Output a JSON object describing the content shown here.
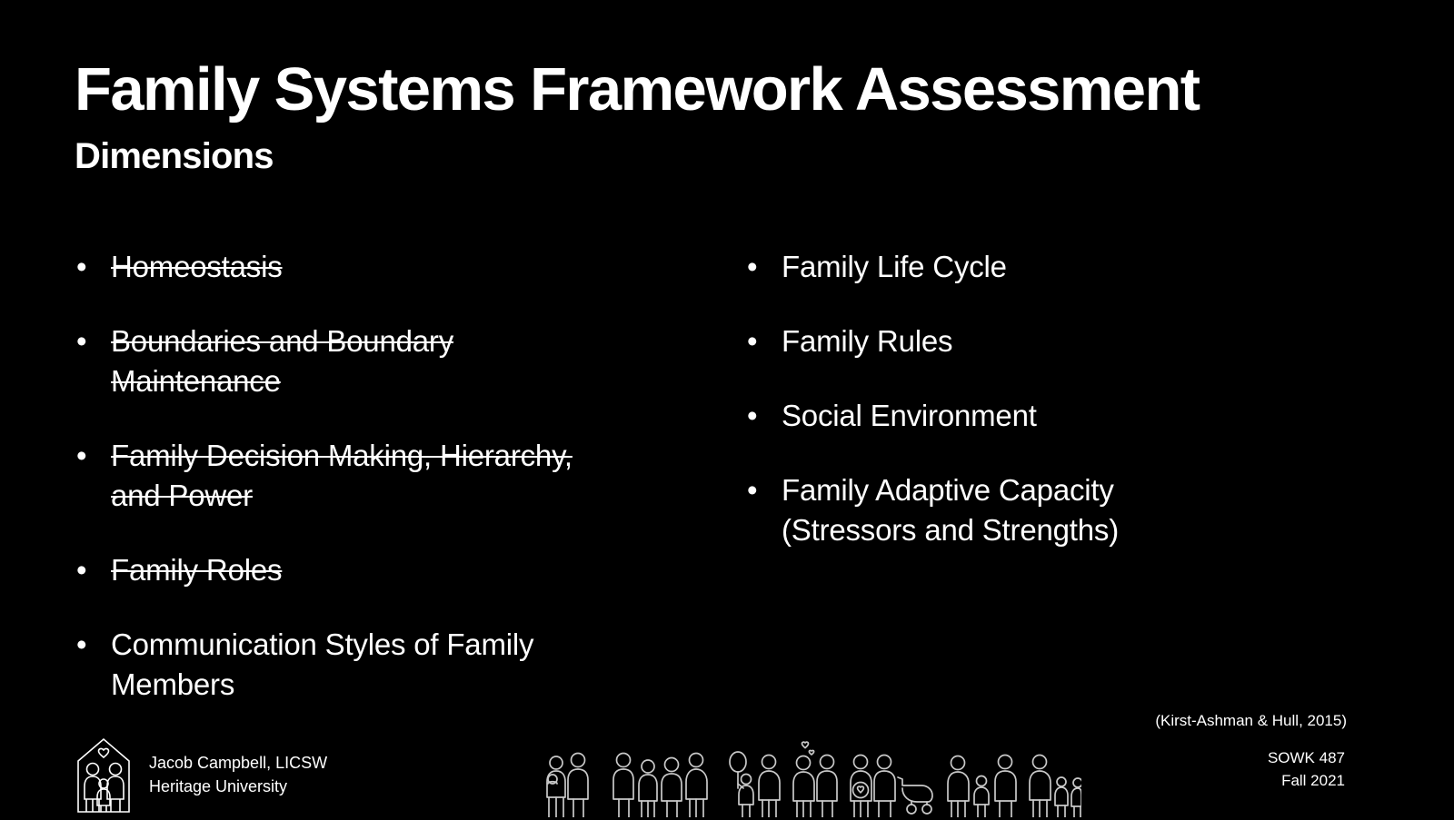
{
  "slide": {
    "background_color": "#000000",
    "text_color": "#ffffff",
    "title": "Family Systems Framework Assessment",
    "subtitle": "Dimensions"
  },
  "columns": {
    "left": [
      {
        "text": "Homeostasis",
        "struck": true,
        "bullet": "•"
      },
      {
        "text": "Boundaries and Boundary\nMaintenance",
        "struck": true,
        "bullet": "•"
      },
      {
        "text": "Family Decision Making, Hierarchy,\nand Power",
        "struck": true,
        "bullet": "•"
      },
      {
        "text": "Family Roles",
        "struck": true,
        "bullet": "•"
      },
      {
        "text": "Communication Styles of Family\nMembers",
        "struck": false,
        "bullet": "•"
      }
    ],
    "right": [
      {
        "text": "Family Life Cycle",
        "struck": false,
        "bullet": "•"
      },
      {
        "text": "Family Rules",
        "struck": false,
        "bullet": "•"
      },
      {
        "text": "Social Environment",
        "struck": false,
        "bullet": "•"
      },
      {
        "text": "Family Adaptive Capacity\n(Stressors and Strengths)",
        "struck": false,
        "bullet": "•"
      }
    ]
  },
  "footer": {
    "citation": "(Kirst-Ashman & Hull, 2015)",
    "author_name": "Jacob Campbell, LICSW",
    "author_affiliation": "Heritage University",
    "course_code": "SOWK 487",
    "course_term": "Fall 2021",
    "logo_icon": "family-house-logo-icon",
    "pictogram_icon": "family-figures-pictogram-icon"
  }
}
